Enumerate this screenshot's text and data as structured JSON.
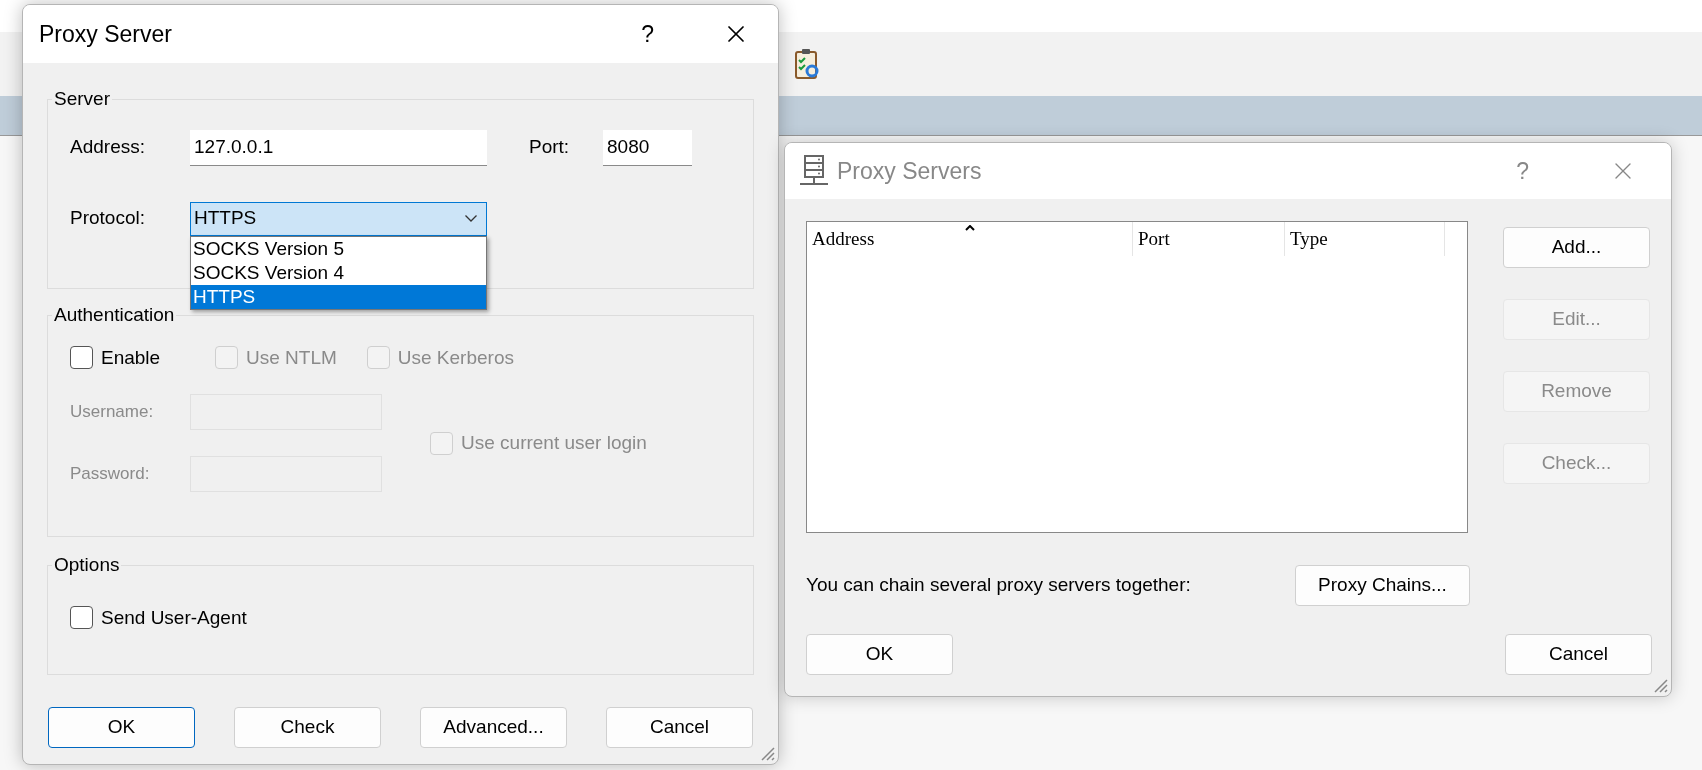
{
  "proxy_server_dialog": {
    "title": "Proxy Server",
    "help": "?",
    "server": {
      "legend": "Server",
      "address_label": "Address:",
      "address_value": "127.0.0.1",
      "port_label": "Port:",
      "port_value": "8080",
      "protocol_label": "Protocol:",
      "protocol_value": "HTTPS",
      "dropdown_open": true,
      "options": [
        {
          "label": "SOCKS Version 5",
          "selected": false
        },
        {
          "label": "SOCKS Version 4",
          "selected": false
        },
        {
          "label": "HTTPS",
          "selected": true
        }
      ]
    },
    "authentication": {
      "legend": "Authentication",
      "checkboxes": [
        {
          "label": "Enable",
          "checked": false,
          "disabled": false
        },
        {
          "label": "Use NTLM",
          "checked": false,
          "disabled": true
        },
        {
          "label": "Use Kerberos",
          "checked": false,
          "disabled": true
        }
      ],
      "fields": [
        {
          "label": "Username:",
          "disabled": true
        },
        {
          "label": "Password:",
          "disabled": true
        }
      ],
      "user_login": {
        "label": "Use current user login",
        "checked": false,
        "disabled": true
      }
    },
    "options": {
      "legend": "Options",
      "checkboxes": [
        {
          "label": "Send User-Agent",
          "checked": false,
          "disabled": false
        }
      ]
    },
    "buttons": [
      {
        "label": "OK",
        "default": true
      },
      {
        "label": "Check",
        "default": false
      },
      {
        "label": "Advanced...",
        "default": false
      },
      {
        "label": "Cancel",
        "default": false
      }
    ]
  },
  "proxy_servers_dialog": {
    "title": "Proxy Servers",
    "help": "?",
    "columns": [
      {
        "label": "Address",
        "sorted": true
      },
      {
        "label": "Port",
        "sorted": false
      },
      {
        "label": "Type",
        "sorted": false
      }
    ],
    "side_buttons": [
      {
        "label": "Add...",
        "disabled": false
      },
      {
        "label": "Edit...",
        "disabled": true
      },
      {
        "label": "Remove",
        "disabled": true
      },
      {
        "label": "Check...",
        "disabled": true
      }
    ],
    "chain_text": "You can chain several proxy servers together:",
    "chain_button": "Proxy Chains...",
    "buttons": [
      {
        "label": "OK",
        "default": false
      },
      {
        "label": "Cancel",
        "default": false
      }
    ]
  }
}
